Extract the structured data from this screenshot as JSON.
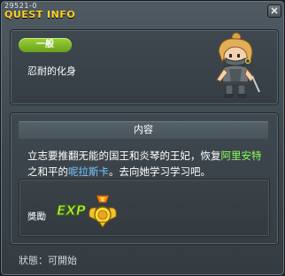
{
  "window": {
    "quest_id": "29521-0",
    "title": "QUEST INFO",
    "close_icon": "close-icon"
  },
  "quest": {
    "category": "一般",
    "name": "忍耐的化身",
    "npc_icon": "ninja-npc-sprite"
  },
  "content": {
    "header": "内容",
    "description_parts": {
      "p1": "立志要推翻无能的国王和炎琴的王妃，恢复",
      "h1": "阿里安特",
      "p2": "之和平的",
      "h2": "呢拉斯卡",
      "p3": "。去向她学习学习吧。"
    }
  },
  "reward": {
    "label": "獎勵",
    "exp_icon": "exp-icon",
    "medal_icon": "medal-icon"
  },
  "status": {
    "text": "狀態：可開始"
  },
  "colors": {
    "title": "#ffd21e",
    "badge": "#8cc832",
    "highlight_green": "#8cff5a",
    "highlight_blue": "#78c8ff"
  }
}
